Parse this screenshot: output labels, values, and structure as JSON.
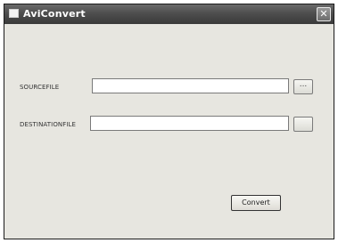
{
  "window": {
    "title": "AviConvert",
    "close_glyph": "✕"
  },
  "form": {
    "source_label": "SOURCEFILE",
    "source_value": "",
    "source_browse": "...",
    "destination_label": "DESTINATIONFILE",
    "destination_value": "",
    "destination_browse": ""
  },
  "actions": {
    "convert_label": "Convert"
  },
  "icons": {
    "app": "app-icon",
    "close": "close-icon"
  }
}
